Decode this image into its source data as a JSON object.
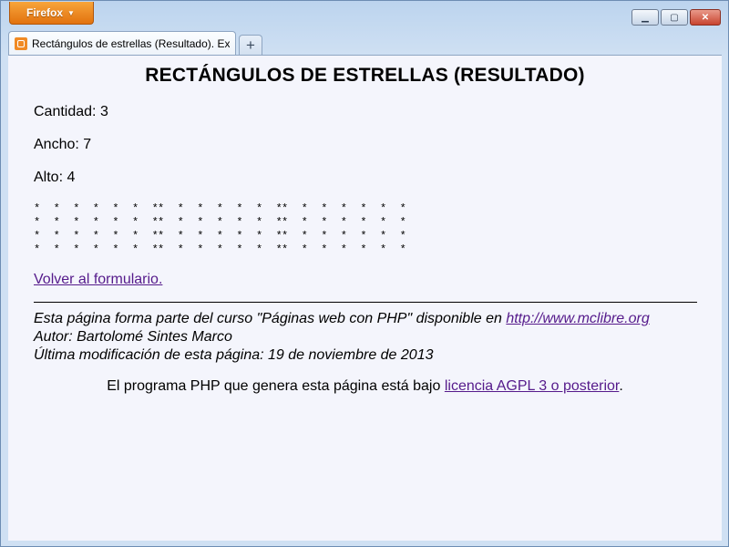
{
  "browser": {
    "menu_button": "Firefox",
    "tab_title": "Rectángulos de estrellas (Resultado). Exá...",
    "new_tab": "+",
    "controls": {
      "minimize": "▁",
      "maximize": "▢",
      "close": "✕"
    }
  },
  "page": {
    "heading": "RECTÁNGULOS DE ESTRELLAS (RESULTADO)",
    "cantidad": "Cantidad: 3",
    "ancho": "Ancho: 7",
    "alto": "Alto: 4",
    "rectangles": {
      "count": 3,
      "width": 7,
      "height": 4,
      "rows": [
        "* * * * * * *",
        "* * * * * * *",
        "* * * * * * *",
        "* * * * * * *"
      ]
    },
    "back_link": "Volver al formulario.",
    "footer": {
      "line1_prefix": "Esta página forma parte del curso \"Páginas web con PHP\" disponible en ",
      "line1_link": "http://www.mclibre.org",
      "line2": "Autor: Bartolomé Sintes Marco",
      "line3": "Última modificación de esta página: 19 de noviembre de 2013"
    },
    "license": {
      "prefix": "El programa PHP que genera esta página está bajo ",
      "link": "licencia AGPL 3 o posterior",
      "suffix": "."
    }
  }
}
